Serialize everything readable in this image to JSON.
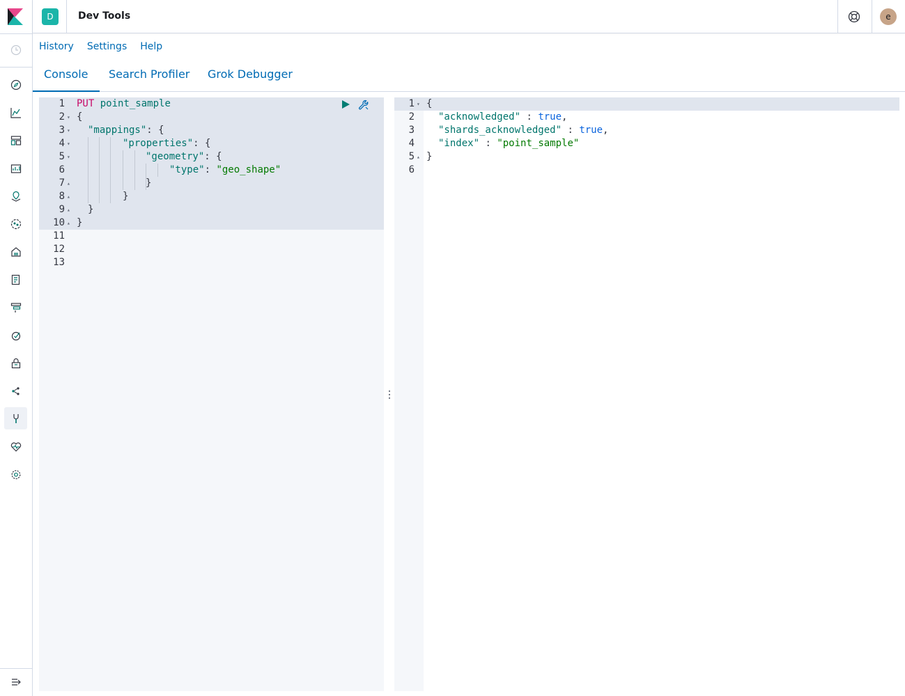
{
  "header": {
    "space_initial": "D",
    "title": "Dev Tools",
    "avatar_initial": "e"
  },
  "top_menu": {
    "history": "History",
    "settings": "Settings",
    "help": "Help"
  },
  "tabs": {
    "console": "Console",
    "search_profiler": "Search Profiler",
    "grok_debugger": "Grok Debugger"
  },
  "request_editor": {
    "method": "PUT",
    "path": "point_sample",
    "lines": [
      {
        "n": "1"
      },
      {
        "n": "2",
        "text": "{"
      },
      {
        "n": "3",
        "key": "\"mappings\"",
        "rest": ": {"
      },
      {
        "n": "4",
        "key": "\"properties\"",
        "rest": ": {"
      },
      {
        "n": "5",
        "key": "\"geometry\"",
        "rest": ": {"
      },
      {
        "n": "6",
        "key": "\"type\"",
        "colon": ": ",
        "value": "\"geo_shape\""
      },
      {
        "n": "7",
        "text": "}"
      },
      {
        "n": "8",
        "text": "}"
      },
      {
        "n": "9",
        "text": "}"
      },
      {
        "n": "10",
        "text": "}"
      },
      {
        "n": "11"
      },
      {
        "n": "12"
      },
      {
        "n": "13"
      }
    ]
  },
  "response_editor": {
    "lines": [
      {
        "n": "1",
        "text": "{"
      },
      {
        "n": "2",
        "key": "\"acknowledged\"",
        "sep": " : ",
        "value": "true",
        "end": ","
      },
      {
        "n": "3",
        "key": "\"shards_acknowledged\"",
        "sep": " : ",
        "value": "true",
        "end": ","
      },
      {
        "n": "4",
        "key": "\"index\"",
        "sep": " : ",
        "value": "\"point_sample\"",
        "end": ""
      },
      {
        "n": "5",
        "text": "}"
      },
      {
        "n": "6"
      }
    ]
  },
  "icons": {
    "nav": [
      "recently-viewed-icon",
      "discover-icon",
      "visualize-icon",
      "dashboard-icon",
      "canvas-icon",
      "maps-icon",
      "ml-icon",
      "infrastructure-icon",
      "logs-icon",
      "apm-icon",
      "uptime-icon",
      "siem-icon",
      "graph-icon",
      "dev-tools-icon",
      "monitoring-icon",
      "management-icon",
      "dock-navigation-icon"
    ],
    "run": "play-icon",
    "settings": "wrench-icon"
  },
  "colors": {
    "accent": "#006bb4",
    "space_badge": "#1bb5a9",
    "method": "#c80a68",
    "string": "#047a02"
  }
}
